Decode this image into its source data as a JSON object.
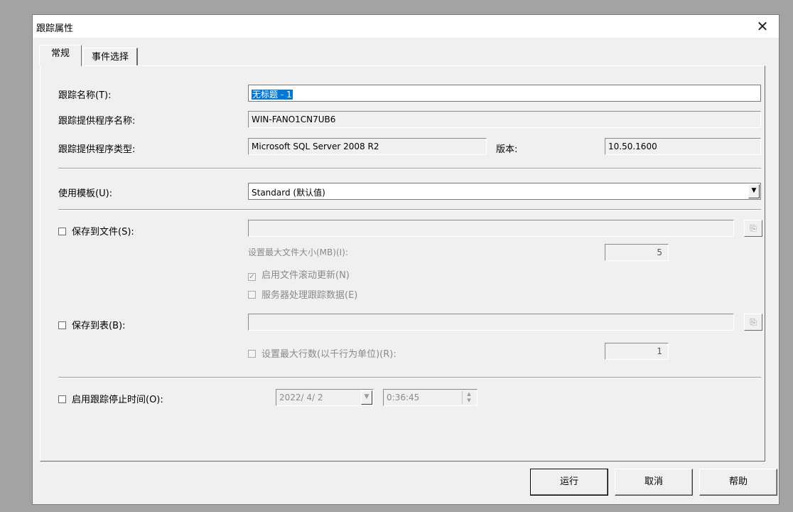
{
  "dialog": {
    "title": "跟踪属性",
    "close_glyph": "✕"
  },
  "tabs": [
    {
      "label": "常规",
      "active": true
    },
    {
      "label": "事件选择",
      "active": false
    }
  ],
  "general": {
    "trace_name_label": "跟踪名称(T):",
    "trace_name_value": "无标题 - 1",
    "provider_name_label": "跟踪提供程序名称:",
    "provider_name_value": "WIN-FANO1CN7UB6",
    "provider_type_label": "跟踪提供程序类型:",
    "provider_type_value": "Microsoft SQL Server 2008 R2",
    "version_label": "版本:",
    "version_value": "10.50.1600",
    "template_label": "使用模板(U):",
    "template_value": "Standard (默认值)",
    "save_to_file_label": "保存到文件(S):",
    "save_to_file_checked": false,
    "save_to_file_path": "",
    "max_file_size_label": "设置最大文件大小(MB)(I):",
    "max_file_size_value": "5",
    "file_rollover_label": "启用文件滚动更新(N)",
    "file_rollover_checked": true,
    "server_process_label": "服务器处理跟踪数据(E)",
    "server_process_checked": false,
    "save_to_table_label": "保存到表(B):",
    "save_to_table_checked": false,
    "save_to_table_value": "",
    "max_rows_label": "设置最大行数(以千行为单位)(R):",
    "max_rows_checked": false,
    "max_rows_value": "1",
    "stop_time_label": "启用跟踪停止时间(O):",
    "stop_time_checked": false,
    "stop_date_value": "2022/ 4/ 2",
    "stop_time_value": "0:36:45"
  },
  "buttons": {
    "run": "运行",
    "cancel": "取消",
    "help": "帮助"
  },
  "icons": {
    "dropdown": "chevron-down-icon",
    "browse": "browse-icon",
    "spin": "spin-icon",
    "close": "close-icon"
  },
  "colors": {
    "selection": "#0078d7",
    "dialog_bg": "#f0f0f0"
  }
}
